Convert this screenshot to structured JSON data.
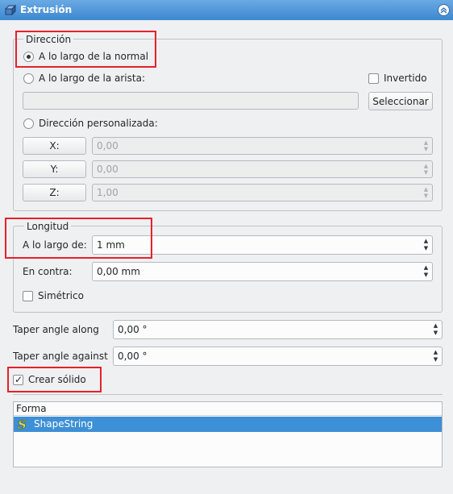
{
  "panel": {
    "title": "Extrusión"
  },
  "direction": {
    "legend": "Dirección",
    "options": [
      {
        "label": "A lo largo de la normal",
        "checked": true
      },
      {
        "label": "A lo largo de la arista:",
        "checked": false
      },
      {
        "label": "Dirección personalizada:",
        "checked": false
      }
    ],
    "edge_field_value": "",
    "inverted_label": "Invertido",
    "inverted_checked": false,
    "select_button": "Seleccionar",
    "axes": [
      {
        "label": "X:",
        "value": "0,00"
      },
      {
        "label": "Y:",
        "value": "0,00"
      },
      {
        "label": "Z:",
        "value": "1,00"
      }
    ]
  },
  "length": {
    "legend": "Longitud",
    "along_label": "A lo largo de:",
    "along_value": "1 mm",
    "against_label": "En contra:",
    "against_value": "0,00 mm",
    "symmetric_label": "Simétrico",
    "symmetric_checked": false
  },
  "taper": {
    "along_label": "Taper angle along",
    "along_value": "0,00 °",
    "against_label": "Taper angle against",
    "against_value": "0,00 °"
  },
  "solid": {
    "label": "Crear sólido",
    "checked": true
  },
  "shapes": {
    "header": "Forma",
    "items": [
      {
        "label": "ShapeString",
        "icon": "shapestring-icon",
        "selected": true
      }
    ]
  },
  "colors": {
    "title_bar": "#3d88d0",
    "highlight": "#e8202a",
    "selection": "#3d8fd6"
  }
}
